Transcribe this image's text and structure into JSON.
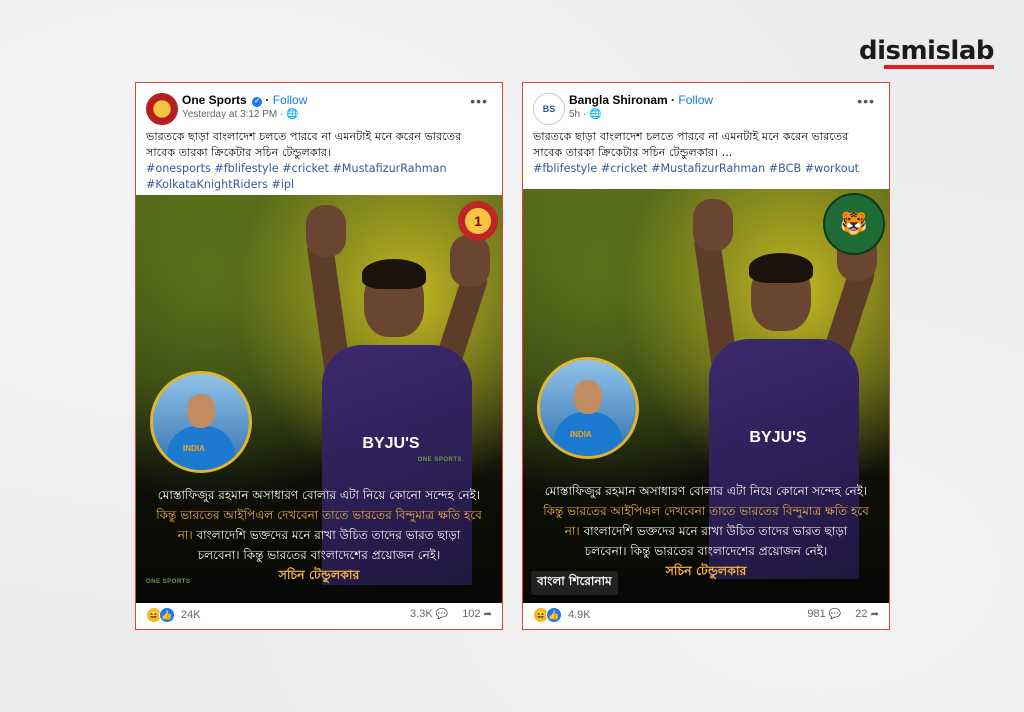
{
  "brand": {
    "name": "dismislab"
  },
  "posts": [
    {
      "page_name": "One Sports",
      "follow": "Follow",
      "timestamp": "Yesterday at 3:12 PM",
      "caption": "ভারতকে ছাড়া বাংলাদেশ চলতে পারবে না এমনটাই মনে করেন ভারতের সাবেক তারকা ক্রিকেটার সচিন টেন্ডুলকার।",
      "hashtags": "#onesports #fblifestyle #cricket #MustafizurRahman #KolkataKnightRiders #ipl",
      "corner_logo": "1",
      "inset_shirt": "INDIA",
      "jersey_text": "BYJU'S",
      "quote_line1": "মোস্তাফিজুর রহমান অসাধারণ বোলার এটা নিয়ে কোনো সন্দেহ নেই।",
      "quote_highlight": "কিন্তু ভারতের আইপিএল দেখবেনা তাতে ভারতের বিন্দুমাত্র ক্ষতি হবে না।",
      "quote_line2": "বাংলাদেশি ভক্তদের মনে রাখা উচিত তাদের ভারত ছাড়া চলবেনা। কিন্তু ভারতের বাংলাদেশের প্রয়োজন নেই।",
      "quote_sign": "সচিন টেন্ডুলকার",
      "media_watermark": "ONE SPORTS",
      "reactions": "24K",
      "comments": "3.3K",
      "shares": "102"
    },
    {
      "page_name": "Bangla Shironam",
      "follow": "Follow",
      "timestamp": "5h",
      "caption": "ভারতকে ছাড়া বাংলাদেশ চলতে পারবে না এমনটাই মনে করেন ভারতের সাবেক তারকা ক্রিকেটার সচিন টেন্ডুলকার। ...",
      "hashtags": "#fblifestyle #cricket #MustafizurRahman #BCB #workout",
      "corner_logo": "🐯",
      "inset_shirt": "INDIA",
      "jersey_text": "BYJU'S",
      "quote_line1": "মোস্তাফিজুর রহমান অসাধারণ বোলার এটা নিয়ে কোনো সন্দেহ নেই।",
      "quote_highlight": "কিন্তু ভারতের আইপিএল দেখবেনা তাতে ভারতের বিন্দুমাত্র ক্ষতি হবে না।",
      "quote_line2": "বাংলাদেশি ভক্তদের মনে রাখা উচিত তাদের ভারত ছাড়া চলবেনা। কিন্তু ভারতের বাংলাদেশের প্রয়োজন নেই।",
      "quote_sign": "সচিন টেন্ডুলকার",
      "bottom_brand": "বাংলা শিরোনাম",
      "reactions": "4.9K",
      "comments": "981",
      "shares": "22"
    }
  ],
  "icons": {
    "verified": "verified-badge-icon",
    "globe": "globe-icon",
    "more": "more-options-icon",
    "comment": "comment-icon",
    "share": "share-icon",
    "haha": "haha-reaction-icon",
    "like": "like-reaction-icon"
  },
  "colors": {
    "border": "#d9463b",
    "link": "#1877f2",
    "hashtag": "#385898",
    "highlight": "#f4b33b",
    "brand_underline": "#d81f26"
  }
}
